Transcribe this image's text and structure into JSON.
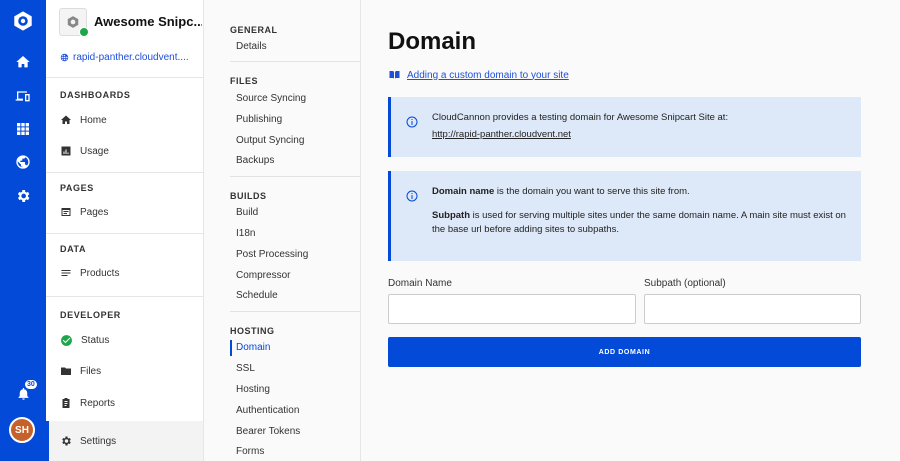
{
  "rail": {
    "icons": [
      "cloudcannon-logo-icon",
      "home-icon",
      "devices-icon",
      "apps-grid-icon",
      "globe-icon",
      "gear-icon"
    ],
    "notification_count": "30",
    "avatar_initials": "SH"
  },
  "site": {
    "name": "Awesome Snipc...",
    "url": "rapid-panther.cloudvent...."
  },
  "sidebar": {
    "sections": [
      {
        "title": "DASHBOARDS",
        "items": [
          {
            "label": "Home",
            "icon": "home-icon"
          },
          {
            "label": "Usage",
            "icon": "chart-icon"
          }
        ]
      },
      {
        "title": "PAGES",
        "items": [
          {
            "label": "Pages",
            "icon": "pages-icon"
          }
        ]
      },
      {
        "title": "DATA",
        "items": [
          {
            "label": "Products",
            "icon": "list-icon"
          }
        ]
      },
      {
        "title": "DEVELOPER",
        "items": [
          {
            "label": "Status",
            "icon": "check-circle-icon"
          },
          {
            "label": "Files",
            "icon": "folder-icon"
          },
          {
            "label": "Reports",
            "icon": "clipboard-icon"
          }
        ]
      }
    ],
    "settings_label": "Settings"
  },
  "settings_nav": {
    "groups": [
      {
        "title": "GENERAL",
        "items": [
          "Details"
        ]
      },
      {
        "title": "FILES",
        "items": [
          "Source Syncing",
          "Publishing",
          "Output Syncing",
          "Backups"
        ]
      },
      {
        "title": "BUILDS",
        "items": [
          "Build",
          "I18n",
          "Post Processing",
          "Compressor",
          "Schedule"
        ]
      },
      {
        "title": "HOSTING",
        "items": [
          "Domain",
          "SSL",
          "Hosting",
          "Authentication",
          "Bearer Tokens",
          "Forms"
        ]
      }
    ],
    "active": "Domain"
  },
  "main": {
    "title": "Domain",
    "help_link": "Adding a custom domain to your site",
    "info1_text": "CloudCannon provides a testing domain for Awesome Snipcart Site at:",
    "info1_link": "http://rapid-panther.cloudvent.net",
    "info2_line1_bold": "Domain name",
    "info2_line1_rest": " is the domain you want to serve this site from.",
    "info2_line2_bold": "Subpath",
    "info2_line2_rest": " is used for serving multiple sites under the same domain name. A main site must exist on the base url before adding sites to subpaths.",
    "domain_label": "Domain Name",
    "domain_value": "",
    "subpath_label": "Subpath (optional)",
    "subpath_value": "",
    "button_label": "ADD DOMAIN"
  },
  "colors": {
    "accent": "#034ad8",
    "info_bg": "#dde8f8",
    "status_green": "#1ea64b",
    "avatar": "#c5612b"
  }
}
